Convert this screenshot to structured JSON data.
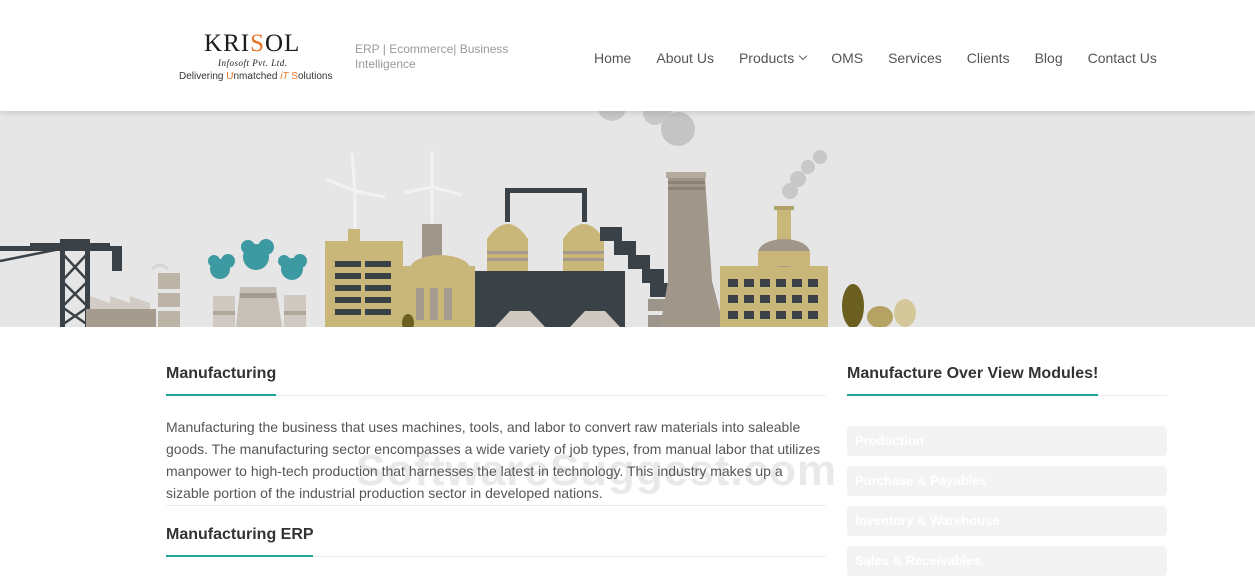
{
  "header": {
    "logo": {
      "brand_k": "K",
      "brand_ri": "RI",
      "brand_s": "S",
      "brand_ol": "OL",
      "sub": "Infosoft Pvt. Ltd.",
      "tag_1": "Delivering ",
      "tag_2": "U",
      "tag_3": "nmatched ",
      "tag_4": "iT",
      "tag_5": " S",
      "tag_6": "olutions"
    },
    "tagline": "ERP | Ecommerce| Business Intelligence",
    "nav": [
      {
        "label": "Home"
      },
      {
        "label": "About Us"
      },
      {
        "label": "Products"
      },
      {
        "label": "OMS"
      },
      {
        "label": "Services"
      },
      {
        "label": "Clients"
      },
      {
        "label": "Blog"
      },
      {
        "label": "Contact Us"
      }
    ]
  },
  "colors": {
    "accent": "#1fa69a",
    "brand_orange": "#e8742a",
    "banner_bg": "#e6e6e6",
    "factory_tan": "#c9b77a",
    "factory_dark": "#3a4147",
    "smoke_teal": "#3d9aa3"
  },
  "main": {
    "section_title": "Manufacturing",
    "paragraph": "Manufacturing the business that uses machines, tools, and labor to convert raw materials into saleable goods. The manufacturing sector encompasses a wide variety of job types, from manual labor that utilizes manpower to high-tech production that harnesses the latest in technology. This industry makes up a sizable portion of the industrial production sector in developed nations.",
    "section2_title": "Manufacturing ERP"
  },
  "sidebar": {
    "title": "Manufacture Over View Modules!",
    "modules": [
      {
        "label": "Production"
      },
      {
        "label": "Purchase & Payables"
      },
      {
        "label": "Inventory & Warehouse"
      },
      {
        "label": "Sales & Receivables"
      }
    ]
  },
  "watermark": "SoftwareSuggest.com"
}
